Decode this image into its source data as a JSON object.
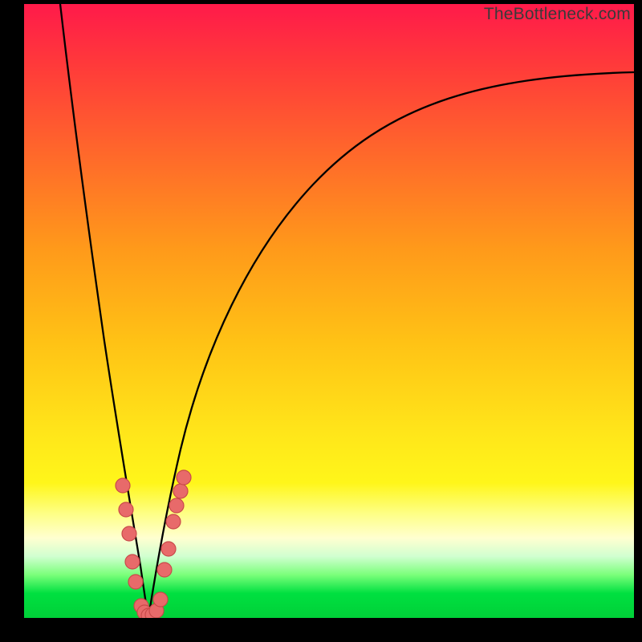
{
  "watermark": "TheBottleneck.com",
  "chart_data": {
    "type": "line",
    "title": "",
    "xlabel": "",
    "ylabel": "",
    "xlim": [
      0,
      100
    ],
    "ylim": [
      0,
      100
    ],
    "gradient_stops": [
      {
        "pct": 0,
        "color": "#ff1a4a"
      },
      {
        "pct": 10,
        "color": "#ff3a3a"
      },
      {
        "pct": 25,
        "color": "#ff6a2a"
      },
      {
        "pct": 40,
        "color": "#ff9a1a"
      },
      {
        "pct": 55,
        "color": "#ffc215"
      },
      {
        "pct": 70,
        "color": "#ffe61a"
      },
      {
        "pct": 78,
        "color": "#fff61a"
      },
      {
        "pct": 83,
        "color": "#feff85"
      },
      {
        "pct": 87,
        "color": "#ffffd0"
      },
      {
        "pct": 90,
        "color": "#d0ffd0"
      },
      {
        "pct": 93,
        "color": "#7aff7a"
      },
      {
        "pct": 96,
        "color": "#00e040"
      },
      {
        "pct": 100,
        "color": "#00d038"
      }
    ],
    "series": [
      {
        "name": "left-branch",
        "x": [
          6,
          8,
          10,
          12,
          14,
          16,
          18,
          19,
          20
        ],
        "y": [
          100,
          80,
          62,
          46,
          32,
          20,
          10,
          4,
          0
        ]
      },
      {
        "name": "right-branch",
        "x": [
          20,
          22,
          25,
          30,
          35,
          40,
          50,
          60,
          70,
          80,
          90,
          100
        ],
        "y": [
          0,
          6,
          18,
          36,
          48,
          57,
          68,
          75,
          79,
          82,
          84,
          85
        ]
      }
    ],
    "markers": [
      {
        "x": 16.0,
        "y": 22
      },
      {
        "x": 16.5,
        "y": 17
      },
      {
        "x": 17.0,
        "y": 13
      },
      {
        "x": 17.5,
        "y": 9
      },
      {
        "x": 18.0,
        "y": 6
      },
      {
        "x": 19.0,
        "y": 2
      },
      {
        "x": 19.5,
        "y": 1
      },
      {
        "x": 20.0,
        "y": 0
      },
      {
        "x": 20.5,
        "y": 0
      },
      {
        "x": 21.0,
        "y": 1
      },
      {
        "x": 21.5,
        "y": 3
      },
      {
        "x": 22.5,
        "y": 8
      },
      {
        "x": 23.0,
        "y": 11
      },
      {
        "x": 24.0,
        "y": 16
      },
      {
        "x": 24.5,
        "y": 18
      },
      {
        "x": 25.0,
        "y": 20
      },
      {
        "x": 25.5,
        "y": 23
      }
    ],
    "marker_style": {
      "fill": "#e86a6a",
      "stroke": "#c94a4a",
      "radius": 9
    }
  }
}
